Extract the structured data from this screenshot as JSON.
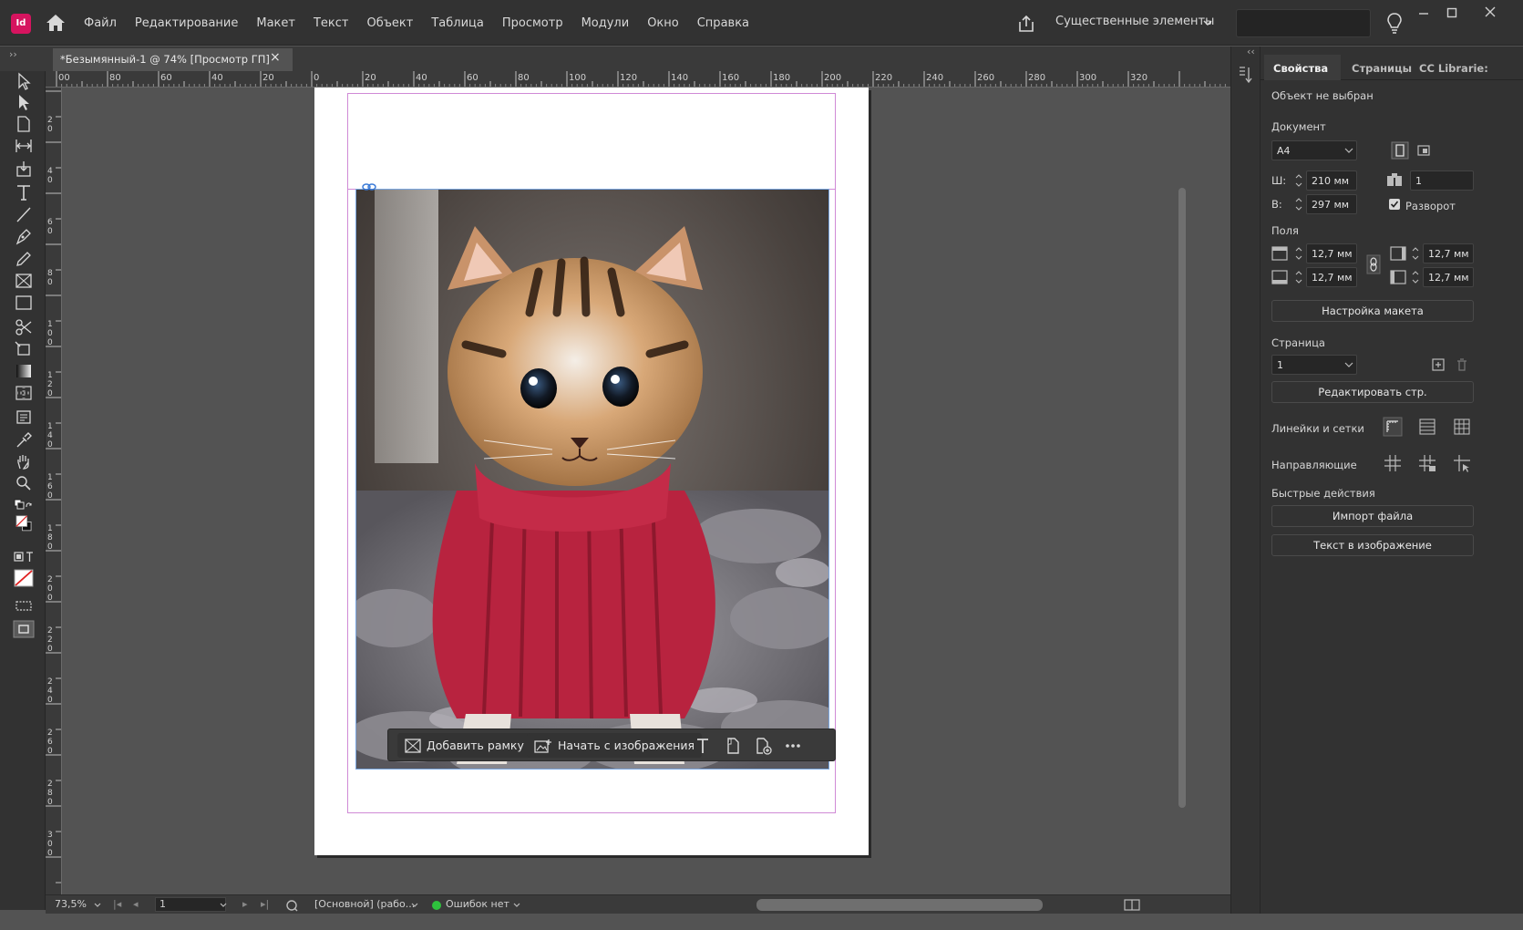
{
  "app": {
    "logo_text": "Id",
    "menu": [
      "Файл",
      "Редактирование",
      "Макет",
      "Текст",
      "Объект",
      "Таблица",
      "Просмотр",
      "Модули",
      "Окно",
      "Справка"
    ],
    "workspace": "Существенные элементы"
  },
  "document": {
    "tab_title": "*Безымянный-1 @ 74% [Просмотр ГП]"
  },
  "rulers": {
    "horizontal_labels": [
      "00",
      "80",
      "60",
      "40",
      "20",
      "0",
      "20",
      "40",
      "60",
      "80",
      "100",
      "120",
      "140",
      "160",
      "180",
      "200",
      "220",
      "240",
      "260",
      "280",
      "300",
      "320"
    ],
    "vertical_labels": [
      "20",
      "40",
      "60",
      "80",
      "100",
      "120",
      "140",
      "160",
      "180",
      "200",
      "220",
      "240",
      "260",
      "280",
      "300"
    ]
  },
  "context_bar": {
    "add_frame": "Добавить рамку",
    "start_from_image": "Начать с изображения"
  },
  "status": {
    "zoom": "73,5%",
    "page": "1",
    "layout": "[Основной] (рабо...",
    "preflight": "Ошибок нет"
  },
  "panel": {
    "tabs": [
      "Свойства",
      "Страницы",
      "CC Librarie:"
    ],
    "no_selection": "Объект не выбран",
    "document_section": "Документ",
    "page_size": "A4",
    "width_label": "Ш:",
    "width_value": "210 мм",
    "height_label": "В:",
    "height_value": "297 мм",
    "pages_count": "1",
    "facing_pages": "Разворот",
    "margins_section": "Поля",
    "margin_top": "12,7 мм",
    "margin_bottom": "12,7 мм",
    "margin_inside": "12,7 мм",
    "margin_outside": "12,7 мм",
    "layout_setup_button": "Настройка макета",
    "page_section": "Страница",
    "page_value": "1",
    "edit_page_button": "Редактировать стр.",
    "rulers_grids": "Линейки и сетки",
    "guides": "Направляющие",
    "quick_actions": "Быстрые действия",
    "import_file_button": "Импорт файла",
    "text_to_image_button": "Текст в изображение"
  },
  "colors": {
    "accent_logo": "#d6145f",
    "margin_guide": "#d08ad6",
    "frame_edge": "#7aa6e0",
    "status_ok": "#2ec23d",
    "sweater": "#b8233f"
  },
  "icons": [
    "home-icon",
    "share-icon",
    "chevron-down-icon",
    "lightbulb-icon",
    "minimize-icon",
    "maximize-icon",
    "close-icon",
    "link-icon",
    "frame-icon",
    "image-icon",
    "text-icon",
    "page-icon",
    "more-icon"
  ]
}
